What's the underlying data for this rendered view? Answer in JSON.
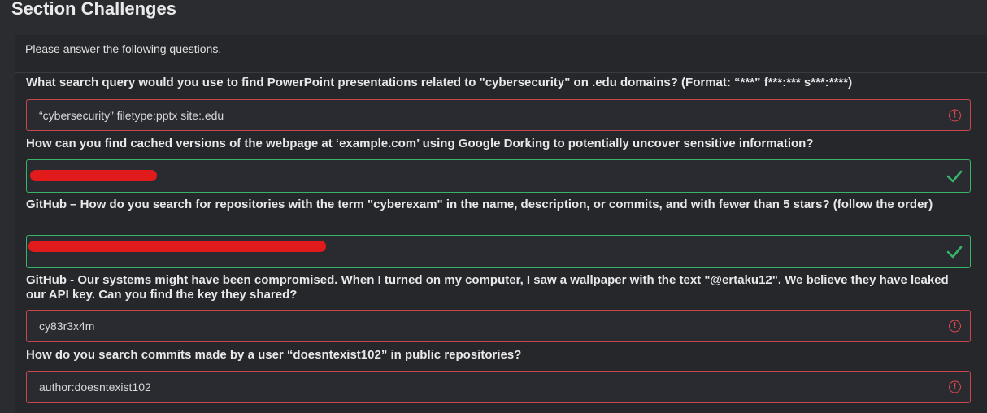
{
  "page": {
    "title": "Section Challenges",
    "intro": "Please answer the following questions."
  },
  "colors": {
    "background": "#2b2c30",
    "error": "#e0484d",
    "success": "#3ab36a",
    "redaction": "#e11b1b"
  },
  "questions": [
    {
      "text": "What search query would you use to find PowerPoint presentations related to \"cybersecurity\" on .edu domains? (Format: “***” f***:*** s***:****)",
      "answer": "“cybersecurity” filetype:pptx site:.edu",
      "status": "error",
      "status_icon": "error-circle-icon"
    },
    {
      "text": "How can you find cached versions of the webpage at ‘example.com’ using Google Dorking to potentially uncover sensitive information?",
      "answer": "",
      "status": "correct",
      "status_icon": "checkmark-icon"
    },
    {
      "text": "GitHub – How do you search for repositories with the term \"cyberexam\" in the name, description, or commits, and with fewer than 5 stars? (follow the order)",
      "answer": "",
      "status": "correct",
      "status_icon": "checkmark-icon"
    },
    {
      "text": "GitHub - Our systems might have been compromised. When I turned on my computer, I saw a wallpaper with the text \"@ertaku12\". We believe they have leaked our API key. Can you find the key they shared?",
      "answer": "cy83r3x4m",
      "status": "error",
      "status_icon": "error-circle-icon"
    },
    {
      "text": "How do you search commits made by a user “doesntexist102” in public repositories?",
      "answer": "author:doesntexist102",
      "status": "error",
      "status_icon": "error-circle-icon"
    }
  ]
}
